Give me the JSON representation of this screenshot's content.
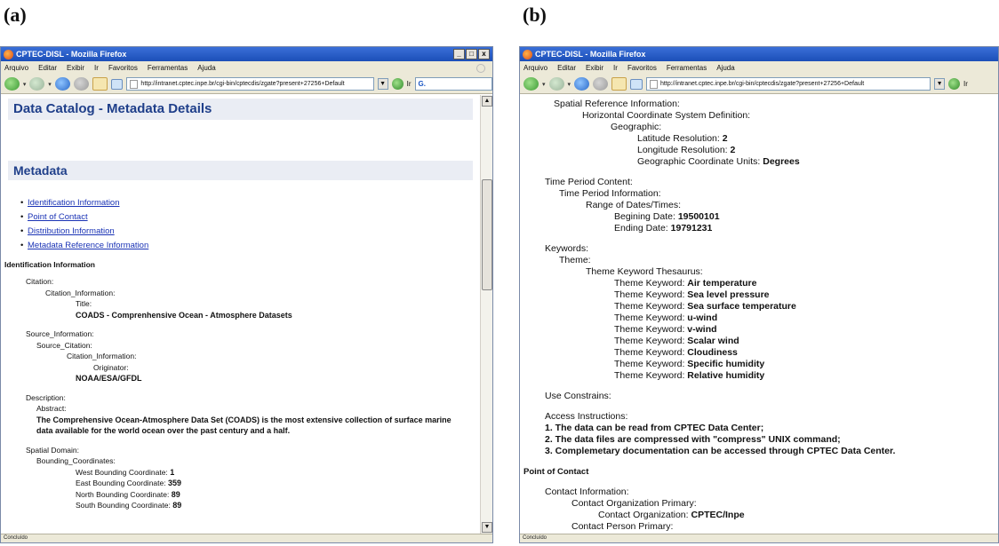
{
  "panels": {
    "a_label": "(a)",
    "b_label": "(b)"
  },
  "browser": {
    "title": "CPTEC-DISL - Mozilla Firefox",
    "menu": [
      "Arquivo",
      "Editar",
      "Exibir",
      "Ir",
      "Favoritos",
      "Ferramentas",
      "Ajuda"
    ],
    "url_a": "http://intranet.cptec.inpe.br/cgi-bin/cptecdis/zgate?present+27256+Default",
    "url_b": "http://intranet.cptec.inpe.br/cgi-bin/cptecdis/zgate?present+27256+Default",
    "go_label": "Ir",
    "search_placeholder": "G.",
    "status": "Concluído",
    "min_icon": "_",
    "max_icon": "□",
    "close_icon": "x"
  },
  "panel_a": {
    "heading": "Data Catalog - Metadata Details",
    "metadata_heading": "Metadata",
    "toc": [
      "Identification Information",
      "Point of Contact",
      "Distribution Information",
      "Metadata Reference Information"
    ],
    "section": "Identification Information",
    "citation_lines": [
      "Citation:",
      "Citation_Information:",
      "Title:"
    ],
    "title_value": "COADS - Comprenhensive Ocean - Atmosphere Datasets",
    "source_lines": [
      "Source_Information:",
      "Source_Citation:",
      "Citation_Information:",
      "Originator:"
    ],
    "originator_value": "NOAA/ESA/GFDL",
    "description_lines": [
      "Description:",
      "Abstract:"
    ],
    "abstract_value": "The Comprehensive Ocean-Atmosphere Data Set (COADS) is the most extensive collection of surface marine data available for the world ocean over the past century and a half.",
    "spatial_lines": [
      "Spatial Domain:",
      "Bounding_Coordinates:"
    ],
    "coords": [
      {
        "label": "West Bounding Coordinate:",
        "value": "1"
      },
      {
        "label": "East Bounding Coordinate:",
        "value": "359"
      },
      {
        "label": "North Bounding Coordinate:",
        "value": "89"
      },
      {
        "label": "South Bounding Coordinate:",
        "value": "89"
      }
    ]
  },
  "panel_b": {
    "spatial_ref": "Spatial Reference Information:",
    "horiz": "Horizontal Coordinate System Definition:",
    "geographic": "Geographic:",
    "lat_label": "Latitude Resolution:",
    "lat_value": "2",
    "lon_label": "Longitude Resolution:",
    "lon_value": "2",
    "units_label": "Geographic Coordinate Units:",
    "units_value": "Degrees",
    "time_period": "Time Period Content:",
    "time_info": "Time Period Information:",
    "range": "Range of Dates/Times:",
    "begin_label": "Begining Date:",
    "begin_value": "19500101",
    "end_label": "Ending Date:",
    "end_value": "19791231",
    "keywords": "Keywords:",
    "theme": "Theme:",
    "thesaurus": "Theme Keyword Thesaurus:",
    "kw_label": "Theme Keyword:",
    "theme_keywords": [
      "Air temperature",
      "Sea level pressure",
      "Sea surface temperature",
      "u-wind",
      "v-wind",
      "Scalar wind",
      "Cloudiness",
      "Specific humidity",
      "Relative humidity"
    ],
    "use_constrains": "Use Constrains:",
    "access": "Access Instructions:",
    "access_lines": [
      "1. The data can be read from CPTEC Data Center;",
      "2. The data files are compressed with \"compress\" UNIX command;",
      "3. Complemetary documentation can be accessed through CPTEC Data Center."
    ],
    "poc_heading": "Point of Contact",
    "contact_info": "Contact Information:",
    "org_primary": "Contact Organization Primary:",
    "org_label": "Contact Organization:",
    "org_value": "CPTEC/Inpe",
    "person_primary": "Contact Person Primary:"
  }
}
